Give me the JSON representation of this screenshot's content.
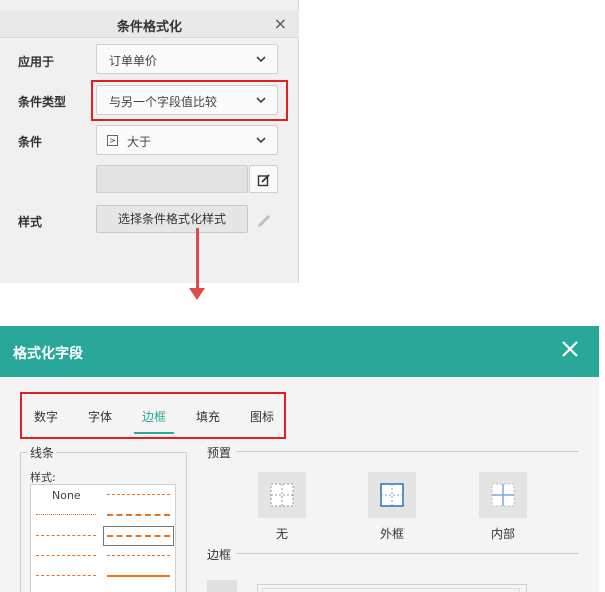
{
  "top_dialog": {
    "title": "条件格式化",
    "close_symbol": "×",
    "apply_to": {
      "label": "应用于",
      "value": "订单单价"
    },
    "condition_type": {
      "label": "条件类型",
      "value": "与另一个字段值比较"
    },
    "condition": {
      "label": "条件",
      "icon_text": ">",
      "value": "大于"
    },
    "style": {
      "label": "样式",
      "button_label": "选择条件格式化样式"
    }
  },
  "bottom_dialog": {
    "title": "格式化字段",
    "tabs": [
      {
        "label": "数字"
      },
      {
        "label": "字体"
      },
      {
        "label": "边框"
      },
      {
        "label": "填充"
      },
      {
        "label": "图标"
      }
    ],
    "active_tab": "边框",
    "lines_group": {
      "label": "线条",
      "style_label": "样式:",
      "none_option": "None"
    },
    "preset_group": {
      "label": "预置",
      "options": [
        "无",
        "外框",
        "内部"
      ]
    },
    "border_group": {
      "label": "边框"
    }
  },
  "colors": {
    "header_teal": "#29a89a",
    "highlight_red": "#e02020",
    "arrow_red": "#e24a4a",
    "line_orange": "#e8741f"
  }
}
